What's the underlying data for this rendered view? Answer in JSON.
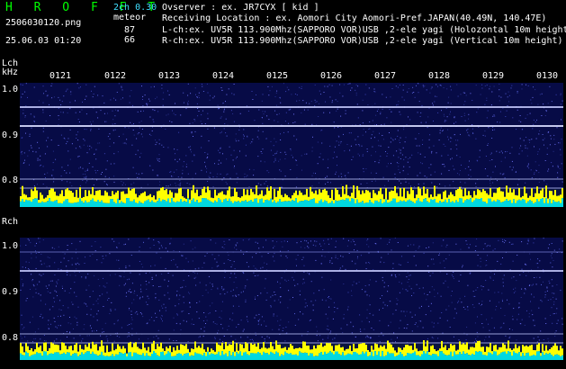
{
  "header": {
    "app_title": "H R O F F T",
    "mode": "2ch 0.30",
    "mode_sub": "meteor",
    "filename": "2506030120.png",
    "datetime": "25.06.03 01:20",
    "count_l": "87",
    "count_r": "66",
    "observer": "Ovserver               : ex. JR7CYX [ kid ]",
    "location": "Receiving Location : ex. Aomori City Aomori-Pref.JAPAN(40.49N, 140.47E)",
    "lch": "L-ch:ex. UV5R 113.900Mhz(SAPPORO VOR)USB ,2-ele yagi (Holozontal 10m height)",
    "rch": "R-ch:ex. UV5R 113.900Mhz(SAPPORO VOR)USB ,2-ele yagi (Vertical 10m height)"
  },
  "time_ticks": [
    "0121",
    "0122",
    "0123",
    "0124",
    "0125",
    "0126",
    "0127",
    "0128",
    "0129",
    "0130"
  ],
  "panels": {
    "left": {
      "channel": "Lch",
      "unit": "kHz",
      "y_labels": [
        "1.0",
        "0.9",
        "0.8"
      ]
    },
    "right": {
      "channel": "Rch",
      "y_labels": [
        "1.0",
        "0.9",
        "0.8"
      ]
    }
  },
  "colors": {
    "background": "#000000",
    "spectrum_bg": "#080c48",
    "level_yellow": "#ffff00",
    "level_cyan": "#00e0e0",
    "signal": "#c8ccff"
  }
}
